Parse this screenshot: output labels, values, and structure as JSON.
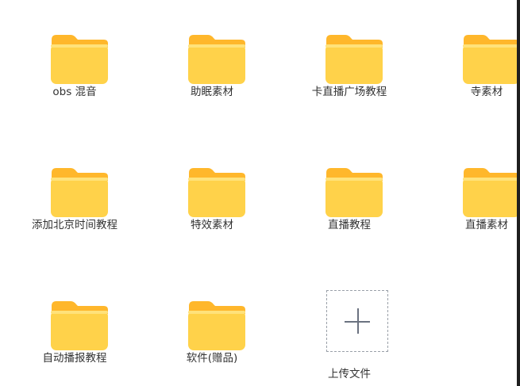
{
  "folder_color": "#FFD24A",
  "folder_tab_color": "#FFB72B",
  "items": [
    {
      "label": "obs 混音",
      "icon": "folder-icon"
    },
    {
      "label": "助眠素材",
      "icon": "folder-icon"
    },
    {
      "label": "卡直播广场教程",
      "icon": "folder-icon"
    },
    {
      "label": "寺素材",
      "icon": "folder-icon"
    },
    {
      "label": "添加北京时间教程",
      "icon": "folder-icon"
    },
    {
      "label": "特效素材",
      "icon": "folder-icon"
    },
    {
      "label": "直播教程",
      "icon": "folder-icon"
    },
    {
      "label": "直播素材",
      "icon": "folder-icon"
    },
    {
      "label": "自动播报教程",
      "icon": "folder-icon"
    },
    {
      "label": "软件(赠品)",
      "icon": "folder-icon"
    }
  ],
  "upload": {
    "label": "上传文件",
    "icon": "plus-icon"
  }
}
